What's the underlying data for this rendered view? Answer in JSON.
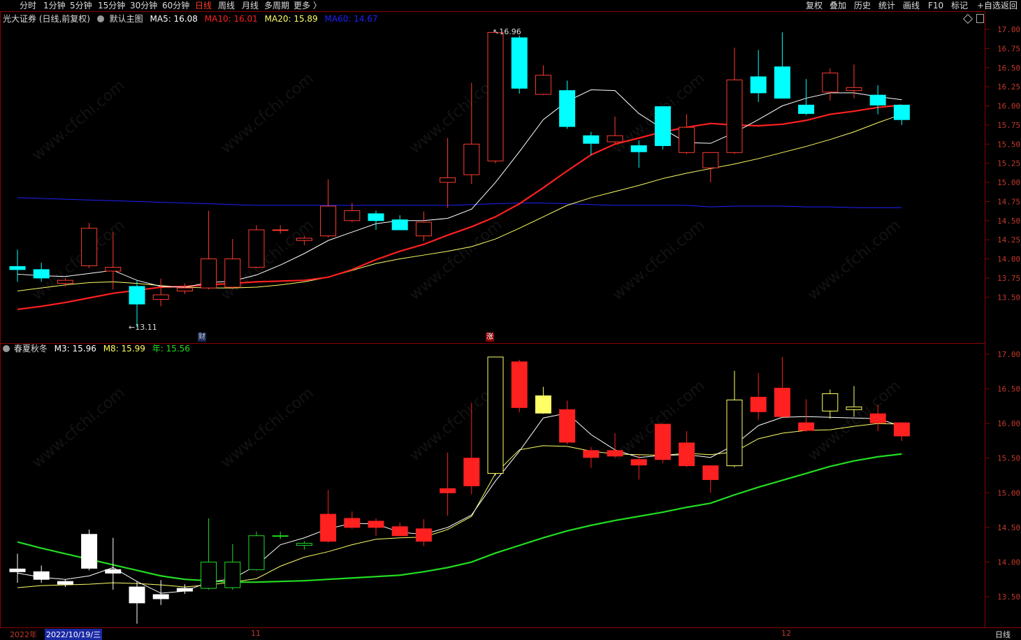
{
  "toolbar": {
    "left_tabs": [
      "分时",
      "1分钟",
      "5分钟",
      "15分钟",
      "30分钟",
      "60分钟",
      "日线",
      "周线",
      "月线",
      "多周期",
      "更多 〉"
    ],
    "active_tab": "日线",
    "right_buttons": [
      "复权",
      "叠加",
      "历史",
      "统计",
      "画线",
      "F10",
      "标记",
      "+自选",
      "返回"
    ]
  },
  "main_chart": {
    "title": "光大证券 (日线,前复权)",
    "template": "默认主图",
    "ma5": "MA5: 16.08",
    "ma10": "MA10: 16.01",
    "ma20": "MA20: 15.89",
    "ma60": "MA60: 14.67",
    "high_label": "16.96",
    "low_label": "13.11",
    "marker_cai": "财",
    "marker_zhang": "涨",
    "y_ticks": [
      "17.00",
      "16.75",
      "16.50",
      "16.25",
      "16.00",
      "15.75",
      "15.50",
      "15.25",
      "15.00",
      "14.75",
      "14.50",
      "14.25",
      "14.00",
      "13.75",
      "13.50"
    ]
  },
  "sub_chart": {
    "title": "春夏秋冬",
    "m3": "M3: 15.96",
    "m8": "M8: 15.99",
    "year": "年: 15.56",
    "y_ticks": [
      "17.00",
      "16.50",
      "16.00",
      "15.50",
      "15.00",
      "14.50",
      "14.00",
      "13.50"
    ]
  },
  "bottom": {
    "year_label": "2022年",
    "date_label": "2022/10/19/三",
    "month_11": "11",
    "month_12": "12",
    "period": "日线"
  },
  "watermark": "www.cfchi.com",
  "colors": {
    "up": "#ff3b30",
    "down": "#00ffff",
    "ma5": "#ffffff",
    "ma10": "#ff2020",
    "ma20": "#ffff66",
    "ma60": "#2020ff",
    "year": "#22dd22",
    "frame": "#8b0000"
  },
  "chart_data": {
    "type": "candlestick",
    "candles": [
      {
        "o": 13.9,
        "h": 14.12,
        "l": 13.7,
        "c": 13.86
      },
      {
        "o": 13.86,
        "h": 13.95,
        "l": 13.7,
        "c": 13.75
      },
      {
        "o": 13.68,
        "h": 13.75,
        "l": 13.64,
        "c": 13.72
      },
      {
        "o": 13.91,
        "h": 14.47,
        "l": 13.88,
        "c": 14.4
      },
      {
        "o": 13.84,
        "h": 14.35,
        "l": 13.6,
        "c": 13.89
      },
      {
        "o": 13.64,
        "h": 13.72,
        "l": 13.11,
        "c": 13.41
      },
      {
        "o": 13.47,
        "h": 13.74,
        "l": 13.38,
        "c": 13.53
      },
      {
        "o": 13.58,
        "h": 13.68,
        "l": 13.54,
        "c": 13.62
      },
      {
        "o": 13.62,
        "h": 14.63,
        "l": 13.6,
        "c": 14.0
      },
      {
        "o": 13.63,
        "h": 14.26,
        "l": 13.6,
        "c": 14.0
      },
      {
        "o": 13.89,
        "h": 14.44,
        "l": 13.88,
        "c": 14.38
      },
      {
        "o": 14.38,
        "h": 14.44,
        "l": 14.33,
        "c": 14.38
      },
      {
        "o": 14.24,
        "h": 14.3,
        "l": 14.18,
        "c": 14.27
      },
      {
        "o": 14.3,
        "h": 15.04,
        "l": 14.28,
        "c": 14.69
      },
      {
        "o": 14.5,
        "h": 14.73,
        "l": 14.48,
        "c": 14.63
      },
      {
        "o": 14.59,
        "h": 14.63,
        "l": 14.38,
        "c": 14.5
      },
      {
        "o": 14.51,
        "h": 14.57,
        "l": 14.38,
        "c": 14.38
      },
      {
        "o": 14.3,
        "h": 14.62,
        "l": 14.23,
        "c": 14.48
      },
      {
        "o": 15.0,
        "h": 15.58,
        "l": 14.67,
        "c": 15.06
      },
      {
        "o": 15.1,
        "h": 16.3,
        "l": 14.98,
        "c": 15.5
      },
      {
        "o": 15.28,
        "h": 16.96,
        "l": 15.25,
        "c": 16.96
      },
      {
        "o": 16.89,
        "h": 16.92,
        "l": 16.16,
        "c": 16.23
      },
      {
        "o": 16.15,
        "h": 16.53,
        "l": 16.14,
        "c": 16.4
      },
      {
        "o": 16.2,
        "h": 16.33,
        "l": 15.7,
        "c": 15.73
      },
      {
        "o": 15.61,
        "h": 15.66,
        "l": 15.36,
        "c": 15.51
      },
      {
        "o": 15.53,
        "h": 15.86,
        "l": 15.5,
        "c": 15.61
      },
      {
        "o": 15.48,
        "h": 15.55,
        "l": 15.19,
        "c": 15.4
      },
      {
        "o": 15.99,
        "h": 15.99,
        "l": 15.43,
        "c": 15.48
      },
      {
        "o": 15.39,
        "h": 15.89,
        "l": 15.37,
        "c": 15.72
      },
      {
        "o": 15.19,
        "h": 15.36,
        "l": 15.0,
        "c": 15.39
      },
      {
        "o": 15.39,
        "h": 16.76,
        "l": 15.37,
        "c": 16.34
      },
      {
        "o": 16.38,
        "h": 16.73,
        "l": 16.05,
        "c": 16.17
      },
      {
        "o": 16.51,
        "h": 16.96,
        "l": 16.1,
        "c": 16.1
      },
      {
        "o": 16.01,
        "h": 16.35,
        "l": 15.88,
        "c": 15.9
      },
      {
        "o": 16.18,
        "h": 16.49,
        "l": 16.07,
        "c": 16.43
      },
      {
        "o": 16.2,
        "h": 16.54,
        "l": 16.1,
        "c": 16.24
      },
      {
        "o": 16.14,
        "h": 16.27,
        "l": 15.89,
        "c": 16.01
      },
      {
        "o": 16.01,
        "h": 16.01,
        "l": 15.75,
        "c": 15.82
      }
    ],
    "ma5": [
      13.8,
      13.78,
      13.77,
      13.81,
      13.85,
      13.72,
      13.64,
      13.63,
      13.69,
      13.71,
      13.79,
      13.92,
      14.07,
      14.24,
      14.35,
      14.46,
      14.5,
      14.5,
      14.53,
      14.65,
      15.0,
      15.4,
      15.82,
      16.06,
      16.21,
      16.2,
      15.9,
      15.7,
      15.52,
      15.51,
      15.65,
      15.82,
      16.0,
      16.1,
      16.17,
      16.17,
      16.12,
      16.08
    ],
    "ma10": [
      13.34,
      13.38,
      13.43,
      13.49,
      13.55,
      13.59,
      13.63,
      13.64,
      13.66,
      13.68,
      13.7,
      13.71,
      13.72,
      13.76,
      13.86,
      13.99,
      14.1,
      14.19,
      14.31,
      14.42,
      14.55,
      14.72,
      14.93,
      15.15,
      15.36,
      15.5,
      15.58,
      15.66,
      15.72,
      15.77,
      15.75,
      15.74,
      15.76,
      15.81,
      15.89,
      15.93,
      15.98,
      16.01
    ],
    "ma20": [
      13.58,
      13.62,
      13.66,
      13.69,
      13.7,
      13.68,
      13.65,
      13.63,
      13.62,
      13.62,
      13.63,
      13.66,
      13.7,
      13.76,
      13.85,
      13.94,
      14.0,
      14.05,
      14.1,
      14.16,
      14.26,
      14.4,
      14.55,
      14.7,
      14.8,
      14.88,
      14.96,
      15.05,
      15.12,
      15.18,
      15.24,
      15.31,
      15.39,
      15.47,
      15.56,
      15.66,
      15.78,
      15.89
    ],
    "ma60": [
      14.8,
      14.79,
      14.78,
      14.77,
      14.76,
      14.75,
      14.74,
      14.73,
      14.72,
      14.71,
      14.7,
      14.7,
      14.7,
      14.7,
      14.7,
      14.7,
      14.7,
      14.7,
      14.7,
      14.71,
      14.72,
      14.73,
      14.73,
      14.72,
      14.71,
      14.7,
      14.7,
      14.7,
      14.7,
      14.68,
      14.69,
      14.69,
      14.69,
      14.68,
      14.68,
      14.67,
      14.67,
      14.67
    ],
    "m3": [
      13.84,
      13.78,
      13.75,
      13.8,
      13.92,
      13.72,
      13.55,
      13.58,
      13.71,
      13.76,
      13.95,
      14.25,
      14.35,
      14.48,
      14.56,
      14.55,
      14.43,
      14.4,
      14.5,
      14.68,
      15.17,
      15.6,
      16.08,
      16.15,
      15.84,
      15.62,
      15.51,
      15.54,
      15.55,
      15.51,
      15.69,
      15.97,
      16.09,
      16.1,
      16.09,
      16.08,
      16.07,
      15.96
    ],
    "m8": [
      13.63,
      13.66,
      13.67,
      13.68,
      13.7,
      13.69,
      13.67,
      13.64,
      13.67,
      13.71,
      13.76,
      13.94,
      14.07,
      14.15,
      14.25,
      14.33,
      14.35,
      14.36,
      14.47,
      14.66,
      15.28,
      15.62,
      15.68,
      15.67,
      15.6,
      15.56,
      15.55,
      15.54,
      15.57,
      15.55,
      15.59,
      15.78,
      15.86,
      15.9,
      15.91,
      15.96,
      16.0,
      15.99
    ],
    "year": [
      14.29,
      14.2,
      14.12,
      14.04,
      13.96,
      13.88,
      13.8,
      13.75,
      13.73,
      13.71,
      13.71,
      13.72,
      13.73,
      13.75,
      13.77,
      13.79,
      13.81,
      13.86,
      13.92,
      14.0,
      14.13,
      14.24,
      14.35,
      14.45,
      14.53,
      14.6,
      14.66,
      14.72,
      14.79,
      14.85,
      14.97,
      15.08,
      15.18,
      15.28,
      15.38,
      15.46,
      15.52,
      15.56
    ],
    "ylim_main": [
      13.11,
      17.0
    ],
    "ylim_sub": [
      13.5,
      17.0
    ]
  }
}
